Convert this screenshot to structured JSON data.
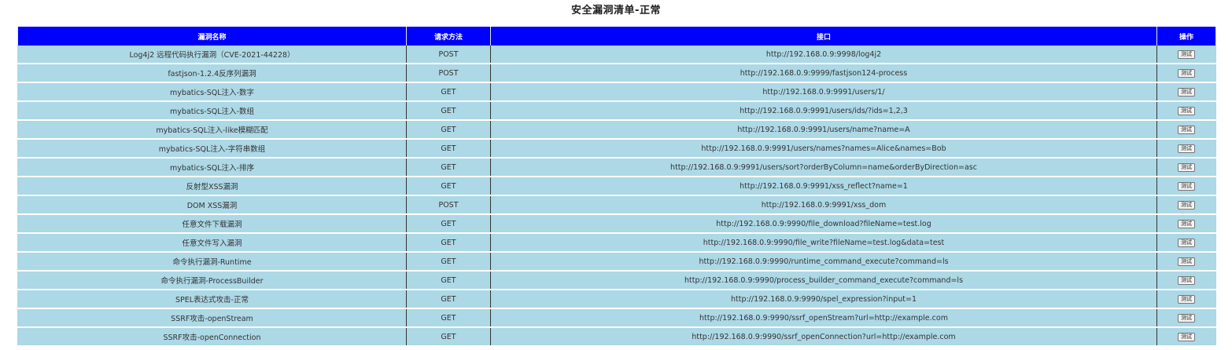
{
  "page": {
    "title": "安全漏洞清单-正常"
  },
  "table": {
    "headers": {
      "name": "漏洞名称",
      "method": "请求方法",
      "endpoint": "接口",
      "action": "操作"
    },
    "test_label": "测试",
    "rows": [
      {
        "name": "Log4j2 远程代码执行漏洞（CVE-2021-44228）",
        "method": "POST",
        "endpoint": "http://192.168.0.9:9998/log4j2"
      },
      {
        "name": "fastjson-1.2.4反序列漏洞",
        "method": "POST",
        "endpoint": "http://192.168.0.9:9999/fastjson124-process"
      },
      {
        "name": "mybatics-SQL注入-数字",
        "method": "GET",
        "endpoint": "http://192.168.0.9:9991/users/1/"
      },
      {
        "name": "mybatics-SQL注入-数组",
        "method": "GET",
        "endpoint": "http://192.168.0.9:9991/users/ids/?ids=1,2,3"
      },
      {
        "name": "mybatics-SQL注入-like模糊匹配",
        "method": "GET",
        "endpoint": "http://192.168.0.9:9991/users/name?name=A"
      },
      {
        "name": "mybatics-SQL注入-字符串数组",
        "method": "GET",
        "endpoint": "http://192.168.0.9:9991/users/names?names=Alice&names=Bob"
      },
      {
        "name": "mybatics-SQL注入-排序",
        "method": "GET",
        "endpoint": "http://192.168.0.9:9991/users/sort?orderByColumn=name&orderByDirection=asc"
      },
      {
        "name": "反射型XSS漏洞",
        "method": "GET",
        "endpoint": "http://192.168.0.9:9991/xss_reflect?name=1"
      },
      {
        "name": "DOM XSS漏洞",
        "method": "POST",
        "endpoint": "http://192.168.0.9:9991/xss_dom"
      },
      {
        "name": "任意文件下载漏洞",
        "method": "GET",
        "endpoint": "http://192.168.0.9:9990/file_download?fileName=test.log"
      },
      {
        "name": "任意文件写入漏洞",
        "method": "GET",
        "endpoint": "http://192.168.0.9:9990/file_write?fileName=test.log&data=test"
      },
      {
        "name": "命令执行漏洞-Runtime",
        "method": "GET",
        "endpoint": "http://192.168.0.9:9990/runtime_command_execute?command=ls"
      },
      {
        "name": "命令执行漏洞-ProcessBuilder",
        "method": "GET",
        "endpoint": "http://192.168.0.9:9990/process_builder_command_execute?command=ls"
      },
      {
        "name": "SPEL表达式攻击-正常",
        "method": "GET",
        "endpoint": "http://192.168.0.9:9990/spel_expression?input=1"
      },
      {
        "name": "SSRF攻击-openStream",
        "method": "GET",
        "endpoint": "http://192.168.0.9:9990/ssrf_openStream?url=http://example.com"
      },
      {
        "name": "SSRF攻击-openConnection",
        "method": "GET",
        "endpoint": "http://192.168.0.9:9990/ssrf_openConnection?url=http://example.com"
      }
    ]
  },
  "colors": {
    "header_bg": "#0000ff",
    "row_bg": "#add8e6"
  }
}
